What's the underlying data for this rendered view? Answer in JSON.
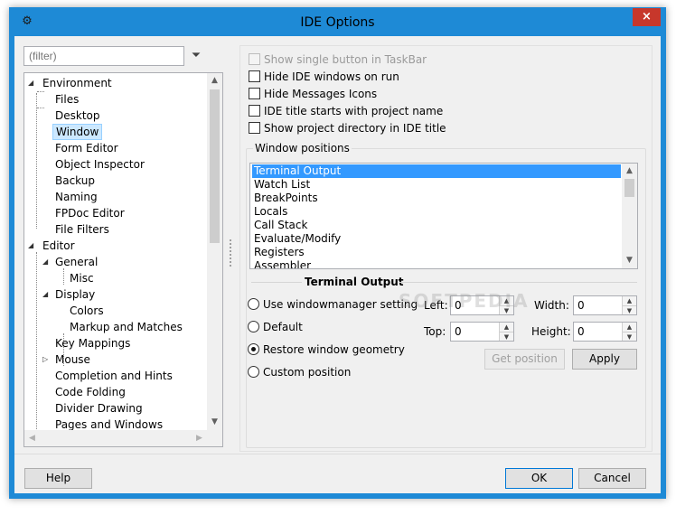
{
  "window": {
    "title": "IDE Options",
    "accent_color": "#1e8ad6",
    "close_icon": "×"
  },
  "filter": {
    "placeholder": "(filter)"
  },
  "tree": {
    "items": [
      {
        "label": "Environment",
        "level": 0,
        "expanded": true
      },
      {
        "label": "Files",
        "level": 1
      },
      {
        "label": "Desktop",
        "level": 1
      },
      {
        "label": "Window",
        "level": 1,
        "selected": true
      },
      {
        "label": "Form Editor",
        "level": 1
      },
      {
        "label": "Object Inspector",
        "level": 1
      },
      {
        "label": "Backup",
        "level": 1
      },
      {
        "label": "Naming",
        "level": 1
      },
      {
        "label": "FPDoc Editor",
        "level": 1
      },
      {
        "label": "File Filters",
        "level": 1
      },
      {
        "label": "Editor",
        "level": 0,
        "expanded": true
      },
      {
        "label": "General",
        "level": 1,
        "expanded": true
      },
      {
        "label": "Misc",
        "level": 2
      },
      {
        "label": "Display",
        "level": 1,
        "expanded": true
      },
      {
        "label": "Colors",
        "level": 2
      },
      {
        "label": "Markup and Matches",
        "level": 2
      },
      {
        "label": "Key Mappings",
        "level": 1
      },
      {
        "label": "Mouse",
        "level": 1,
        "collapsed": true
      },
      {
        "label": "Completion and Hints",
        "level": 1
      },
      {
        "label": "Code Folding",
        "level": 1
      },
      {
        "label": "Divider Drawing",
        "level": 1
      },
      {
        "label": "Pages and Windows",
        "level": 1
      }
    ]
  },
  "options": {
    "show_single_button": "Show single button in TaskBar",
    "hide_ide_windows": "Hide IDE windows on run",
    "hide_messages_icons": "Hide Messages Icons",
    "ide_title_project": "IDE title starts with project name",
    "show_project_dir": "Show project directory in IDE title"
  },
  "window_positions": {
    "group_title": "Window positions",
    "items": [
      "Terminal Output",
      "Watch List",
      "BreakPoints",
      "Locals",
      "Call Stack",
      "Evaluate/Modify",
      "Registers",
      "Assembler"
    ],
    "selected": "Terminal Output"
  },
  "terminal": {
    "section_title": "Terminal Output",
    "radio_use_wm": "Use windowmanager setting",
    "radio_default": "Default",
    "radio_restore": "Restore window geometry",
    "radio_custom": "Custom position",
    "left_label": "Left:",
    "left_value": "0",
    "top_label": "Top:",
    "top_value": "0",
    "width_label": "Width:",
    "width_value": "0",
    "height_label": "Height:",
    "height_value": "0",
    "get_position": "Get position",
    "apply": "Apply"
  },
  "footer": {
    "help": "Help",
    "ok": "OK",
    "cancel": "Cancel"
  },
  "watermark_text": "SOFTPEDIA"
}
